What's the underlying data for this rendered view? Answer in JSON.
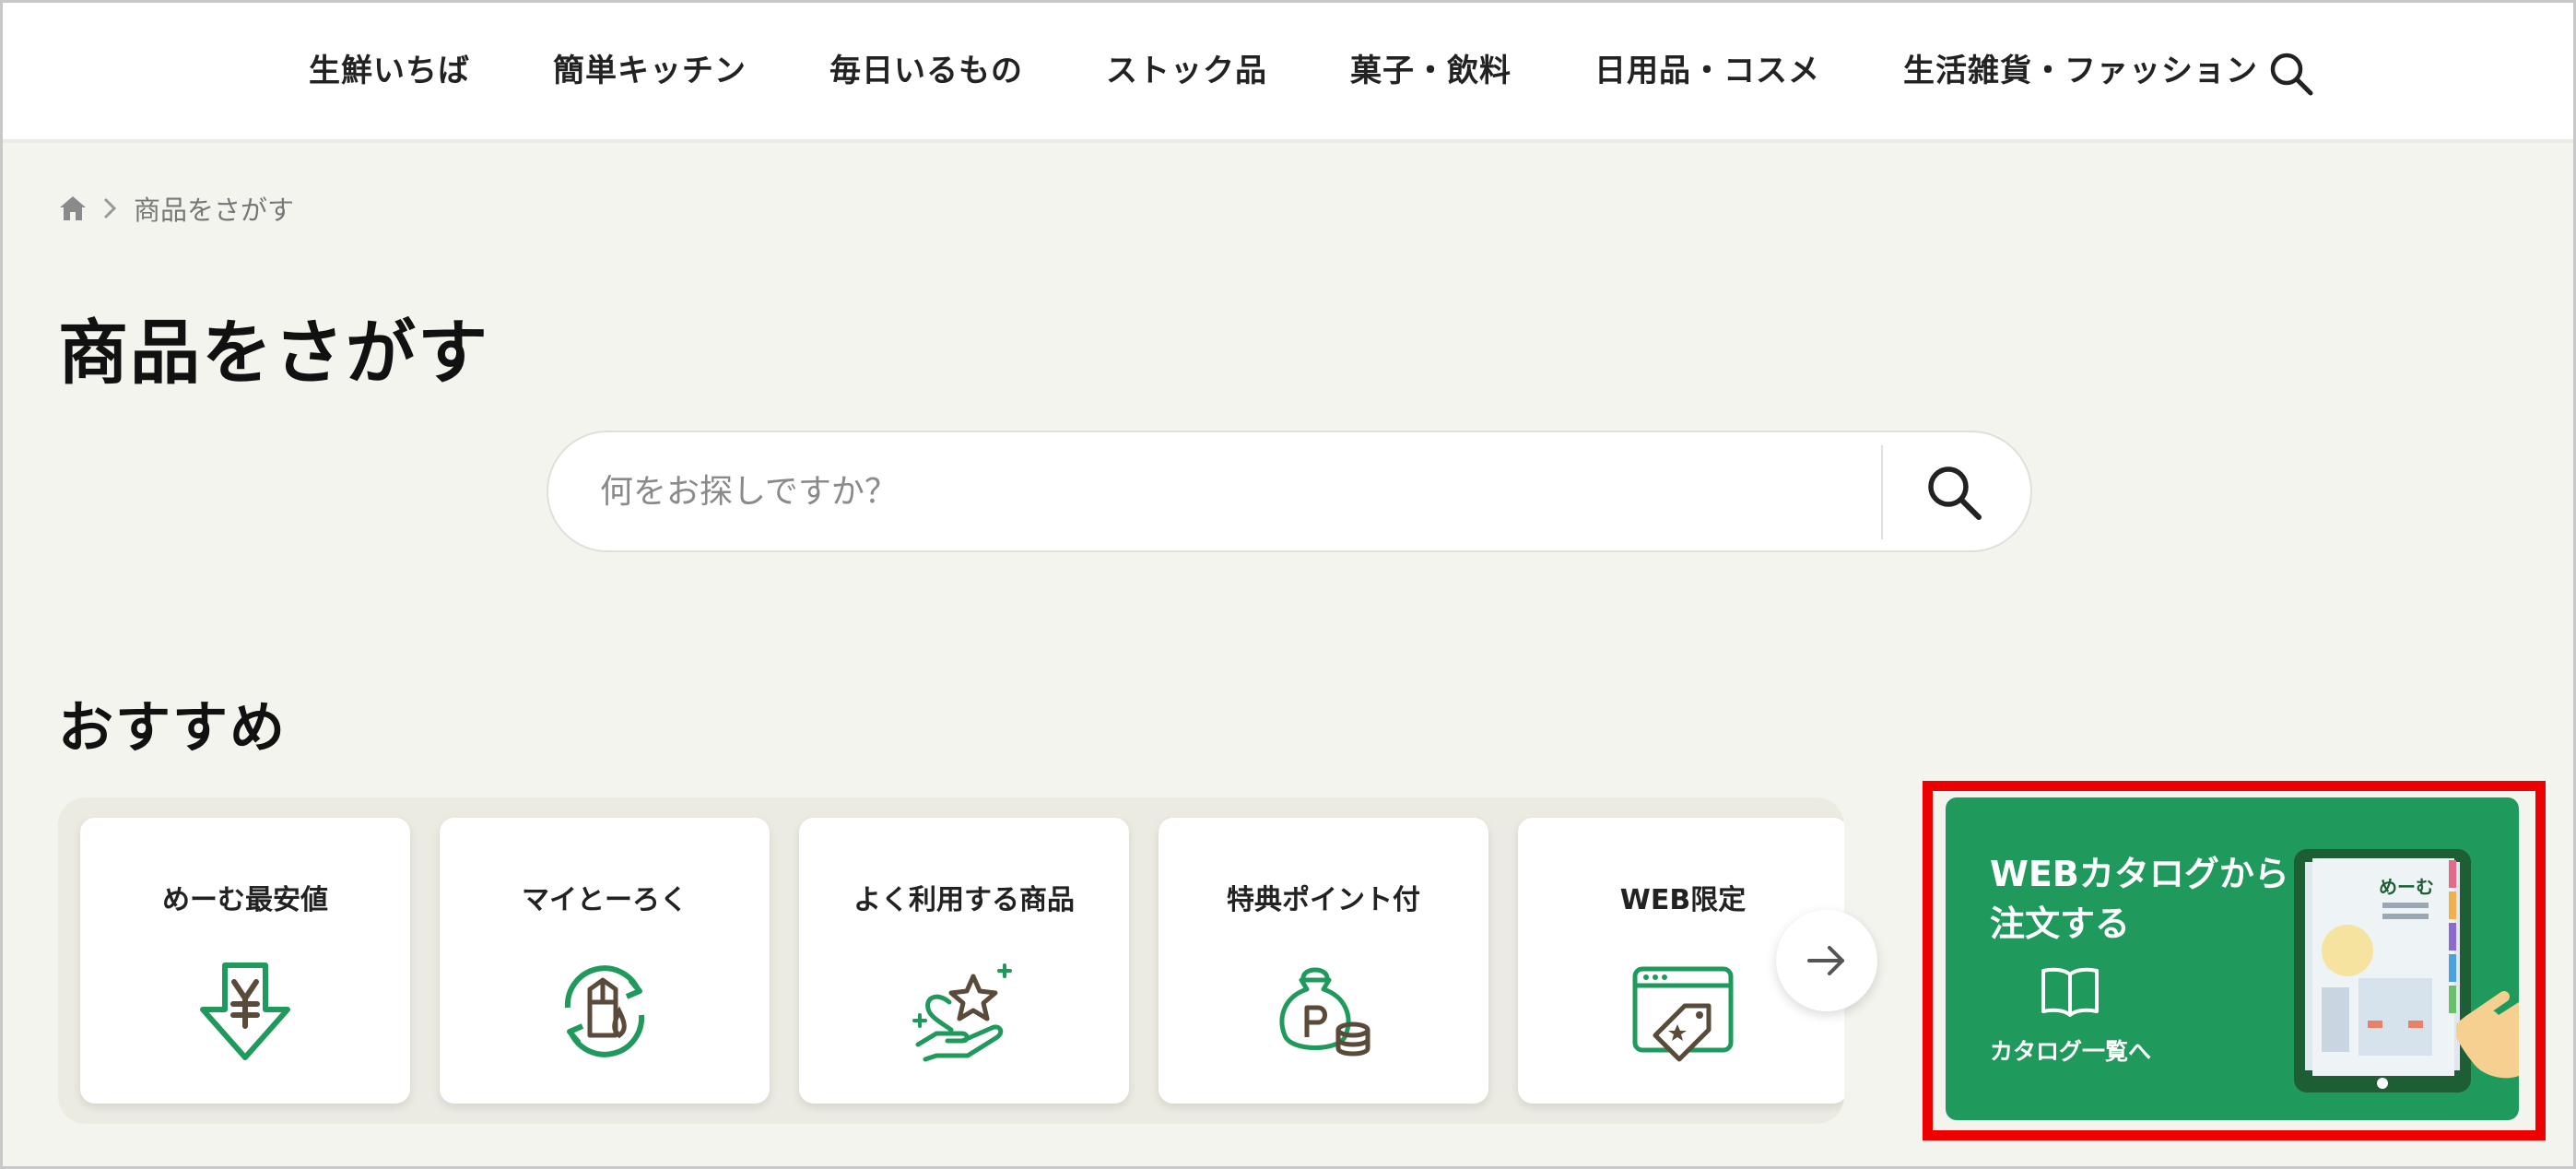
{
  "nav": {
    "items": [
      {
        "label": "生鮮いちば"
      },
      {
        "label": "簡単キッチン"
      },
      {
        "label": "毎日いるもの"
      },
      {
        "label": "ストック品"
      },
      {
        "label": "菓子・飲料"
      },
      {
        "label": "日用品・コスメ"
      },
      {
        "label": "生活雑貨・ファッション"
      }
    ],
    "search_icon": "search-icon"
  },
  "breadcrumb": {
    "home_icon": "home-icon",
    "current": "商品をさがす"
  },
  "page_title": "商品をさがす",
  "search": {
    "value": "",
    "placeholder": "何をお探しですか？",
    "button_icon": "search-icon"
  },
  "recommend": {
    "title": "おすすめ",
    "cards": [
      {
        "label": "めーむ最安値",
        "icon": "yen-down-arrow-icon"
      },
      {
        "label": "マイとーろく",
        "icon": "recycle-milk-icon"
      },
      {
        "label": "よく利用する商品",
        "icon": "heart-star-hand-icon"
      },
      {
        "label": "特典ポイント付",
        "icon": "point-purse-coins-icon"
      },
      {
        "label": "WEB限定",
        "icon": "web-tag-icon"
      }
    ],
    "next_icon": "arrow-right-icon"
  },
  "catalog_banner": {
    "line1": "WEBカタログから",
    "line2": "注文する",
    "link_label": "カタログ一覧へ",
    "icon": "open-book-icon",
    "image": "catalog-tablet-illustration",
    "highlight_color": "#ee0000"
  },
  "colors": {
    "accent_green": "#1f9a5c",
    "icon_brown": "#5a4a3a",
    "page_bg": "#f4f4ef"
  }
}
